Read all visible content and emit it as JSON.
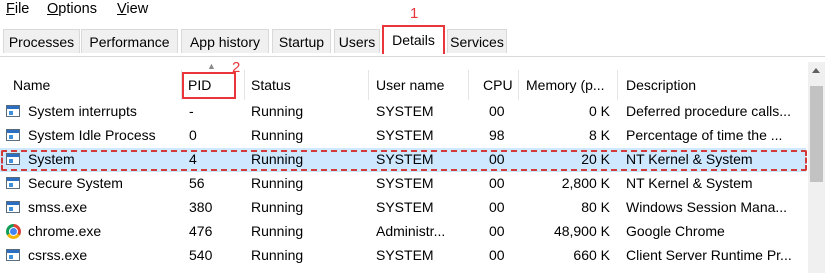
{
  "menu": {
    "file": {
      "u": "F",
      "rest": "ile"
    },
    "options": {
      "u": "O",
      "rest": "ptions"
    },
    "view": {
      "u": "V",
      "rest": "iew"
    }
  },
  "tabs": [
    "Processes",
    "Performance",
    "App history",
    "Startup",
    "Users",
    "Details",
    "Services"
  ],
  "active_tab": "Details",
  "annotations": [
    "1",
    "2"
  ],
  "columns": [
    "Name",
    "PID",
    "Status",
    "User name",
    "CPU",
    "Memory (p...",
    "Description"
  ],
  "rows": [
    {
      "icon": "window-icon",
      "name": "System interrupts",
      "pid": "-",
      "status": "Running",
      "user": "SYSTEM",
      "cpu": "00",
      "mem": "0 K",
      "desc": "Deferred procedure calls..."
    },
    {
      "icon": "window-icon",
      "name": "System Idle Process",
      "pid": "0",
      "status": "Running",
      "user": "SYSTEM",
      "cpu": "98",
      "mem": "8 K",
      "desc": "Percentage of time the ..."
    },
    {
      "icon": "window-icon",
      "name": "System",
      "pid": "4",
      "status": "Running",
      "user": "SYSTEM",
      "cpu": "00",
      "mem": "20 K",
      "desc": "NT Kernel & System",
      "selected": true
    },
    {
      "icon": "window-icon",
      "name": "Secure System",
      "pid": "56",
      "status": "Running",
      "user": "SYSTEM",
      "cpu": "00",
      "mem": "2,800 K",
      "desc": "NT Kernel & System"
    },
    {
      "icon": "window-icon",
      "name": "smss.exe",
      "pid": "380",
      "status": "Running",
      "user": "SYSTEM",
      "cpu": "00",
      "mem": "80 K",
      "desc": "Windows Session Mana..."
    },
    {
      "icon": "chrome-icon",
      "name": "chrome.exe",
      "pid": "476",
      "status": "Running",
      "user": "Administr...",
      "cpu": "00",
      "mem": "48,900 K",
      "desc": "Google Chrome"
    },
    {
      "icon": "window-icon",
      "name": "csrss.exe",
      "pid": "540",
      "status": "Running",
      "user": "SYSTEM",
      "cpu": "00",
      "mem": "660 K",
      "desc": "Client Server Runtime Pr..."
    }
  ],
  "colors": {
    "annotation": "#e8363b",
    "selection": "#cde8ff"
  }
}
